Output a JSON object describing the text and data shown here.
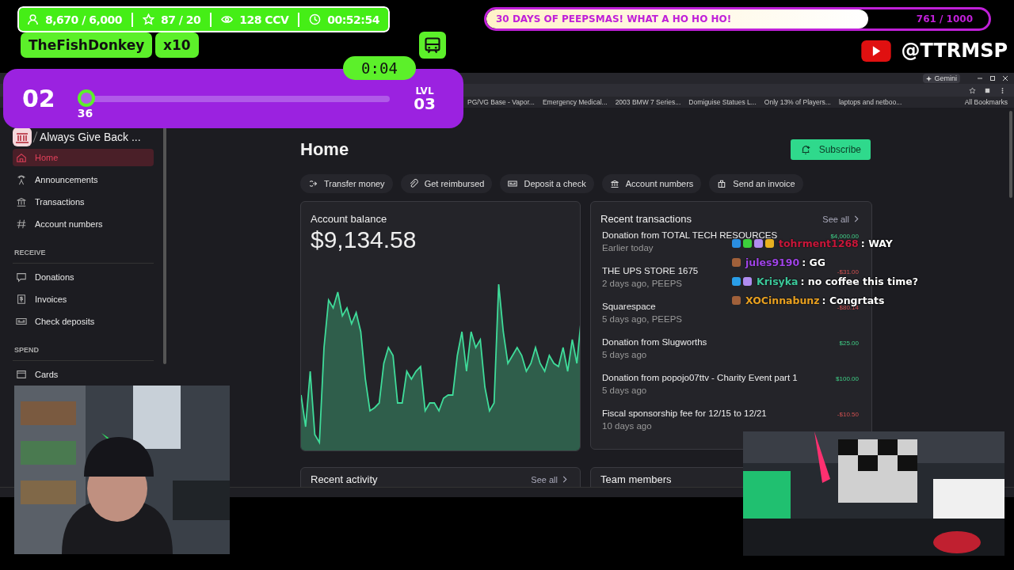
{
  "stream_overlay": {
    "stats": [
      "8,670 / 6,000",
      "87 / 20",
      "128 CCV",
      "00:52:54"
    ],
    "streamer": "TheFishDonkey",
    "multiplier": "x10",
    "timer": "0:04",
    "level_bar": {
      "current": "02",
      "level": 0,
      "points": "36",
      "next_label": "LVL",
      "next": "03"
    },
    "goal": {
      "title": "30 DAYS OF PEEPSMAS! WHAT A HO HO HO!",
      "level": 0.761,
      "reading": "761 / 1000"
    },
    "channel_handle": "@TTRMSP"
  },
  "browser": {
    "gemini": "Gemini",
    "bookmarks": [
      "PG/VG Base - Vapor...",
      "Emergency Medical...",
      "2003 BMW 7 Series...",
      "Domiguise Statues L...",
      "Only 13% of Players...",
      "laptops and netboo..."
    ],
    "all_bookmarks": "All Bookmarks"
  },
  "sidebar": {
    "org": "Always Give Back ...",
    "nav": [
      {
        "label": "Home",
        "selected": true
      },
      {
        "label": "Announcements",
        "selected": false
      },
      {
        "label": "Transactions",
        "selected": false
      },
      {
        "label": "Account numbers",
        "selected": false
      }
    ],
    "sections": [
      {
        "heading": "RECEIVE",
        "items": [
          {
            "label": "Donations",
            "selected": false
          },
          {
            "label": "Invoices",
            "selected": false
          },
          {
            "label": "Check deposits",
            "selected": false
          }
        ]
      },
      {
        "heading": "SPEND",
        "items": [
          {
            "label": "Cards",
            "selected": false
          }
        ]
      }
    ]
  },
  "page": {
    "title": "Home",
    "subscribe": "Subscribe",
    "actions": [
      "Transfer money",
      "Get reimbursed",
      "Deposit a check",
      "Account numbers",
      "Send an invoice"
    ],
    "balance": {
      "label": "Account balance",
      "amount": "$9,134.58"
    },
    "transactions": {
      "title": "Recent transactions",
      "see_all": "See all",
      "rows": [
        {
          "name": "Donation from TOTAL TECH RESOURCES",
          "when": "Earlier today",
          "amount": "$4,000.00",
          "kind": "credit"
        },
        {
          "name": "THE UPS STORE 1675",
          "when": "2 days ago, PEEPS",
          "amount": "-$31.00",
          "kind": "debit"
        },
        {
          "name": "Squarespace",
          "when": "5 days ago, PEEPS",
          "amount": "-$80.14",
          "kind": "debit"
        },
        {
          "name": "Donation from Slugworths",
          "when": "5 days ago",
          "amount": "$25.00",
          "kind": "credit"
        },
        {
          "name": "Donation from popojo07ttv - Charity Event part 1",
          "when": "5 days ago",
          "amount": "$100.00",
          "kind": "credit"
        },
        {
          "name": "Fiscal sponsorship fee for 12/15 to 12/21",
          "when": "10 days ago",
          "amount": "-$10.50",
          "kind": "debit"
        }
      ]
    },
    "recent_activity": {
      "title": "Recent activity",
      "see_all": "See all"
    },
    "team_members": {
      "title": "Team members"
    }
  },
  "chat": [
    {
      "user": "tohrment1268",
      "color": "#c8173a",
      "message": ": WAY"
    },
    {
      "user": "jules9190",
      "color": "#a044e8",
      "message": ": GG"
    },
    {
      "user": "Krisyka",
      "color": "#3cc89a",
      "message": ": no coffee this time?"
    },
    {
      "user": "XOCinnabunz",
      "color": "#e8a020",
      "message": ": Congrtats"
    }
  ]
}
